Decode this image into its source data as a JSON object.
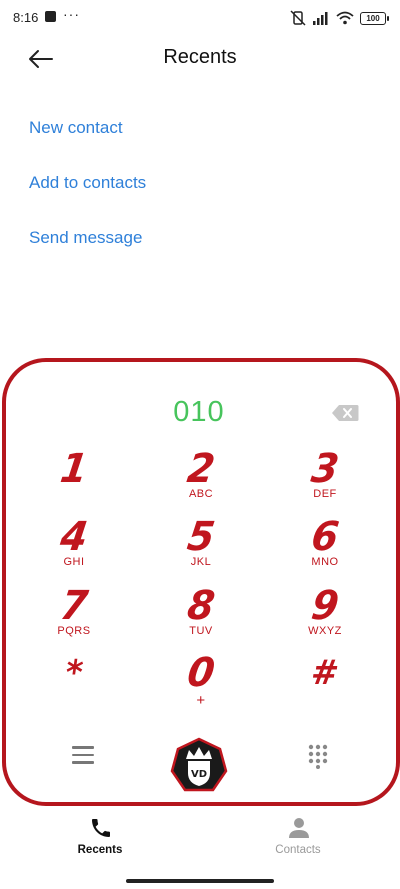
{
  "status_bar": {
    "time": "8:16",
    "dots": "···",
    "battery": "100",
    "icons": [
      "notification-square-icon",
      "vibrate-off-icon",
      "signal-icon",
      "wifi-icon",
      "battery-icon"
    ]
  },
  "header": {
    "title": "Recents",
    "back_icon": "back-arrow-icon"
  },
  "actions": [
    {
      "label": "New contact"
    },
    {
      "label": "Add to contacts"
    },
    {
      "label": "Send message"
    }
  ],
  "dialer": {
    "number": "010",
    "keys": [
      {
        "digit": "1",
        "letters": ""
      },
      {
        "digit": "2",
        "letters": "ABC"
      },
      {
        "digit": "3",
        "letters": "DEF"
      },
      {
        "digit": "4",
        "letters": "GHI"
      },
      {
        "digit": "5",
        "letters": "JKL"
      },
      {
        "digit": "6",
        "letters": "MNO"
      },
      {
        "digit": "7",
        "letters": "PQRS"
      },
      {
        "digit": "8",
        "letters": "TUV"
      },
      {
        "digit": "9",
        "letters": "WXYZ"
      },
      {
        "digit": "*",
        "letters": ""
      },
      {
        "digit": "0",
        "letters": "+"
      },
      {
        "digit": "#",
        "letters": ""
      }
    ],
    "logo_text": "VD",
    "accent_color": "#c0161e",
    "number_color": "#47c45c"
  },
  "nav": {
    "recents_label": "Recents",
    "contacts_label": "Contacts"
  },
  "colors": {
    "link": "#2f80d9",
    "panel_border": "#b5161d"
  }
}
